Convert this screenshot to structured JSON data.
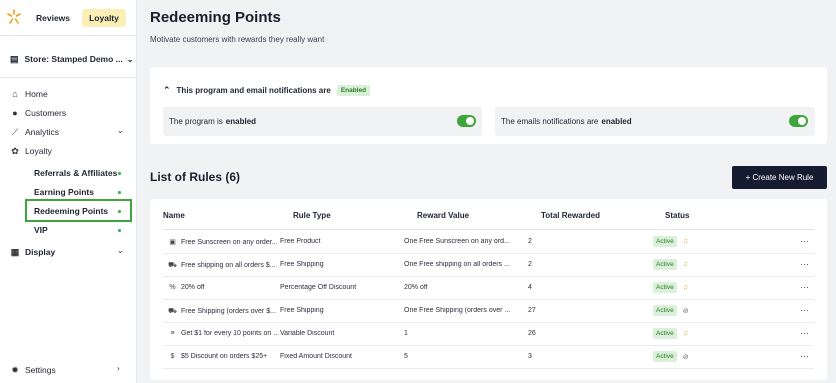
{
  "topbar": {
    "tabs": [
      "Reviews",
      "Loyalty"
    ],
    "active_tab": "Loyalty"
  },
  "sidebar": {
    "store": "Store: Stamped Demo ...",
    "nav": [
      {
        "label": "Home",
        "icon": "home-icon"
      },
      {
        "label": "Customers",
        "icon": "person-icon"
      },
      {
        "label": "Analytics",
        "icon": "chart-icon"
      },
      {
        "label": "Loyalty",
        "icon": "gift-icon"
      }
    ],
    "loyalty_items": [
      "Referrals & Affiliates",
      "Earning Points",
      "Redeeming Points",
      "VIP"
    ],
    "active_item": "Redeeming Points",
    "display": "Display",
    "settings": "Settings"
  },
  "page": {
    "title": "Redeeming Points",
    "subtitle": "Motivate customers with rewards they really want"
  },
  "program": {
    "heading": "This program and email notifications are",
    "badge": "Enabled",
    "program_label": "The program is",
    "program_state": "enabled",
    "emails_label": "The emails notifications are",
    "emails_state": "enabled"
  },
  "rules": {
    "title": "List of Rules (6)",
    "create_button": "+ Create New Rule",
    "columns": [
      "Name",
      "Rule Type",
      "Reward Value",
      "Total Rewarded",
      "Status"
    ],
    "rows": [
      {
        "name": "Free Sunscreen on any order...",
        "type": "Free Product",
        "reward": "One Free Sunscreen on any ord...",
        "total": "2",
        "status": "Active",
        "icon": "product-icon",
        "notify": true
      },
      {
        "name": "Free shipping on all orders $...",
        "type": "Free Shipping",
        "reward": "One Free shipping on all orders ...",
        "total": "2",
        "status": "Active",
        "icon": "truck-icon",
        "notify": true
      },
      {
        "name": "20% off",
        "type": "Percentage Off Discount",
        "reward": "20% off",
        "total": "4",
        "status": "Active",
        "icon": "percent-icon",
        "notify": true
      },
      {
        "name": "Free Shipping (orders over $...",
        "type": "Free Shipping",
        "reward": "One Free Shipping (orders over ...",
        "total": "27",
        "status": "Active",
        "icon": "truck-icon",
        "notify": false
      },
      {
        "name": "Get $1 for every 10 points on ...",
        "type": "Variable Discount",
        "reward": "1",
        "total": "26",
        "status": "Active",
        "icon": "variable-icon",
        "notify": true
      },
      {
        "name": "$5 Discount on orders $25+",
        "type": "Fixed Amount Discount",
        "reward": "5",
        "total": "3",
        "status": "Active",
        "icon": "dollar-icon",
        "notify": false
      }
    ]
  },
  "colors": {
    "accent_green": "#3da53b",
    "badge_bg": "#dbf0d8",
    "button_dark": "#151c32",
    "loyalty_tab": "#fbefb6"
  }
}
